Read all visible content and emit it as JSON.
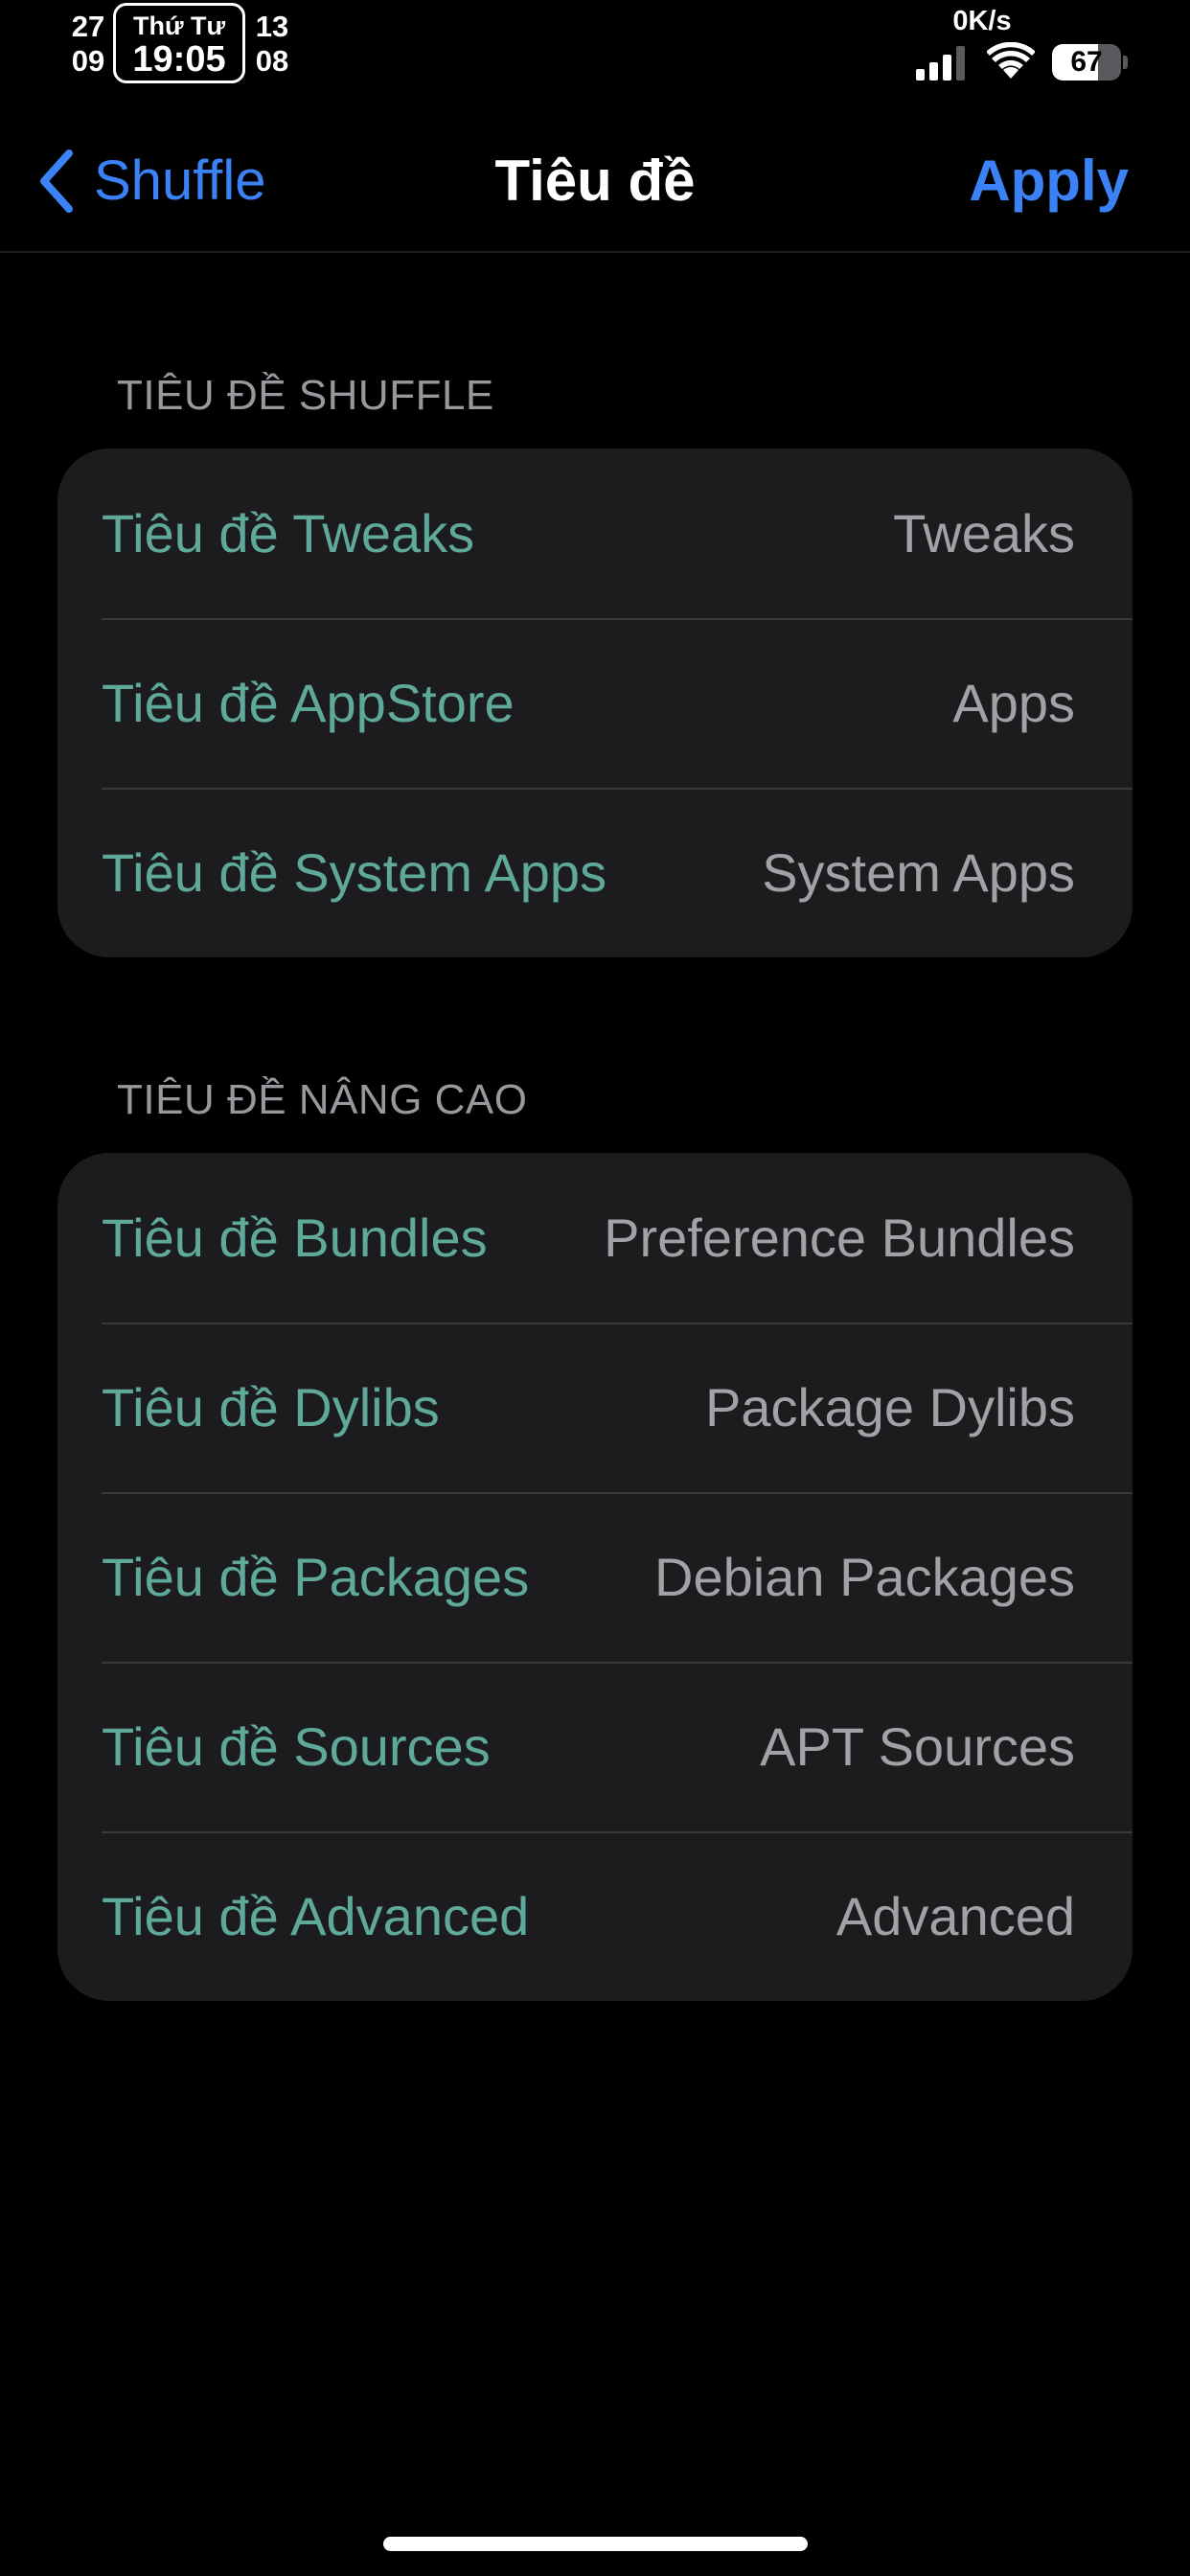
{
  "status_bar": {
    "date_left_top": "27",
    "date_left_bottom": "09",
    "weekday": "Thứ Tư",
    "time": "19:05",
    "date_right_top": "13",
    "date_right_bottom": "08",
    "network_speed": "0K/s",
    "signal_icon": "cellular-signal-icon",
    "wifi_icon": "wifi-icon",
    "battery_percent": "67",
    "battery_level": 0.67
  },
  "nav": {
    "back_label": "Shuffle",
    "back_icon": "chevron-left-icon",
    "title": "Tiêu đề",
    "apply_label": "Apply"
  },
  "sections": [
    {
      "header": "TIÊU ĐỀ SHUFFLE",
      "rows": [
        {
          "label": "Tiêu đề Tweaks",
          "value": "Tweaks"
        },
        {
          "label": "Tiêu đề AppStore",
          "value": "Apps"
        },
        {
          "label": "Tiêu đề System Apps",
          "value": "System Apps"
        }
      ]
    },
    {
      "header": "TIÊU ĐỀ NÂNG CAO",
      "rows": [
        {
          "label": "Tiêu đề Bundles",
          "value": "Preference Bundles"
        },
        {
          "label": "Tiêu đề Dylibs",
          "value": "Package Dylibs"
        },
        {
          "label": "Tiêu đề Packages",
          "value": "Debian Packages"
        },
        {
          "label": "Tiêu đề Sources",
          "value": "APT Sources"
        },
        {
          "label": "Tiêu đề Advanced",
          "value": "Advanced"
        }
      ]
    }
  ],
  "colors": {
    "background": "#000000",
    "accent_blue": "#3b82f6",
    "row_label_teal": "#5fa99b",
    "row_value_gray": "#a1a1a6",
    "group_background": "#1c1c1e",
    "section_header_gray": "#98989e"
  }
}
